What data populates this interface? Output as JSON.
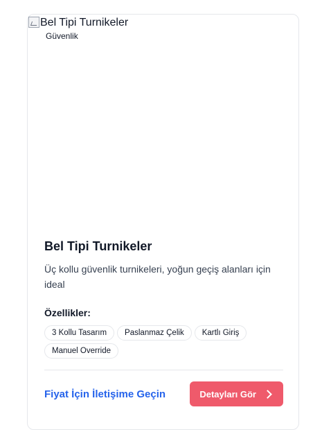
{
  "product": {
    "image_alt": "Bel Tipi Turnikeler",
    "badge": "Güvenlik",
    "title": "Bel Tipi Turnikeler",
    "description": "Üç kollu güvenlik turnikeleri, yoğun geçiş alanları için ideal",
    "features_label": "Özellikler:",
    "features": [
      "3 Kollu Tasarım",
      "Paslanmaz Çelik",
      "Kartlı Giriş",
      "Manuel Override"
    ],
    "contact_label": "Fiyat İçin İletişime Geçin",
    "details_label": "Detayları Gör"
  },
  "colors": {
    "accent_button": "#ef5a6b",
    "link": "#2563eb"
  },
  "icons": {
    "details_button_icon": "chevron-right-icon"
  }
}
